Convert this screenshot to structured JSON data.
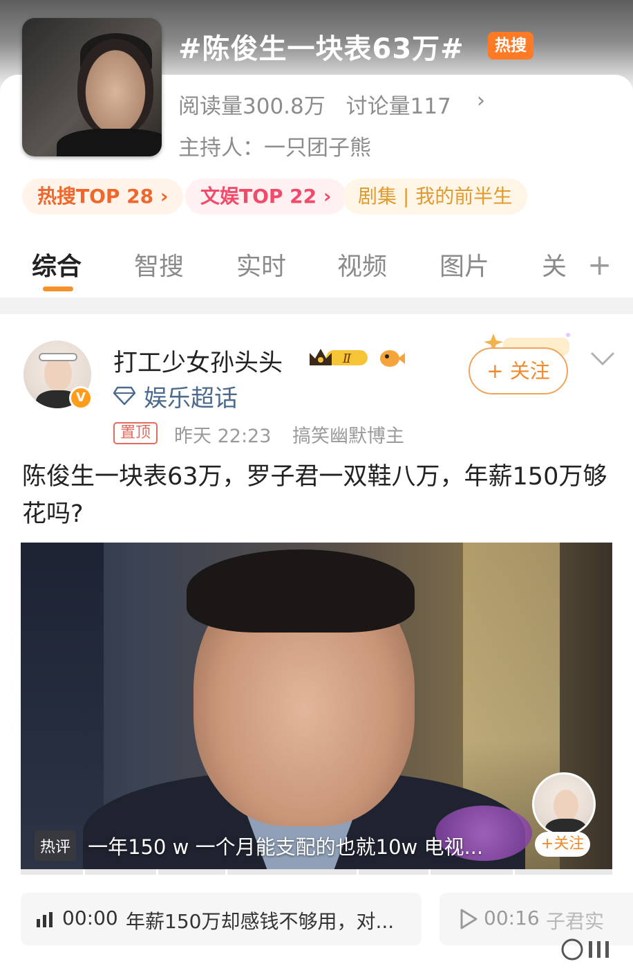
{
  "topic": {
    "title": "#陈俊生一块表63万#",
    "hot_badge": "热搜",
    "reads": "阅读量300.8万",
    "discussions": "讨论量117",
    "host": "主持人：一只团子熊",
    "tags": [
      "热搜TOP 28 ›",
      "文娱TOP 22 ›",
      "剧集 | 我的前半生"
    ]
  },
  "tabs": [
    "综合",
    "智搜",
    "实时",
    "视频",
    "图片",
    "关"
  ],
  "post": {
    "username": "打工少女孙头头",
    "level": "Ⅱ",
    "super_topic": "娱乐超话",
    "follow_label": "+ 关注",
    "pin_label": "置顶",
    "time": "昨天 22:23",
    "role": "搞笑幽默博主",
    "text": "陈俊生一块表63万，罗子君一双鞋八万，年薪150万够花吗?"
  },
  "video": {
    "hot_comment_tag": "热评",
    "hot_comment_text": "一年150 w 一个月能支配的也就10w  电视...",
    "mini_follow": "+关注"
  },
  "chapters": [
    {
      "time": "00:00",
      "text": "年薪150万却感钱不够用，对..."
    },
    {
      "time": "00:16",
      "text": "子君实"
    }
  ],
  "colors": {
    "accent_orange": "#ff7a25",
    "tab_indicator": "#f5922a",
    "super_topic_blue": "#4b6a8d",
    "pin_red": "#e06b5c"
  }
}
